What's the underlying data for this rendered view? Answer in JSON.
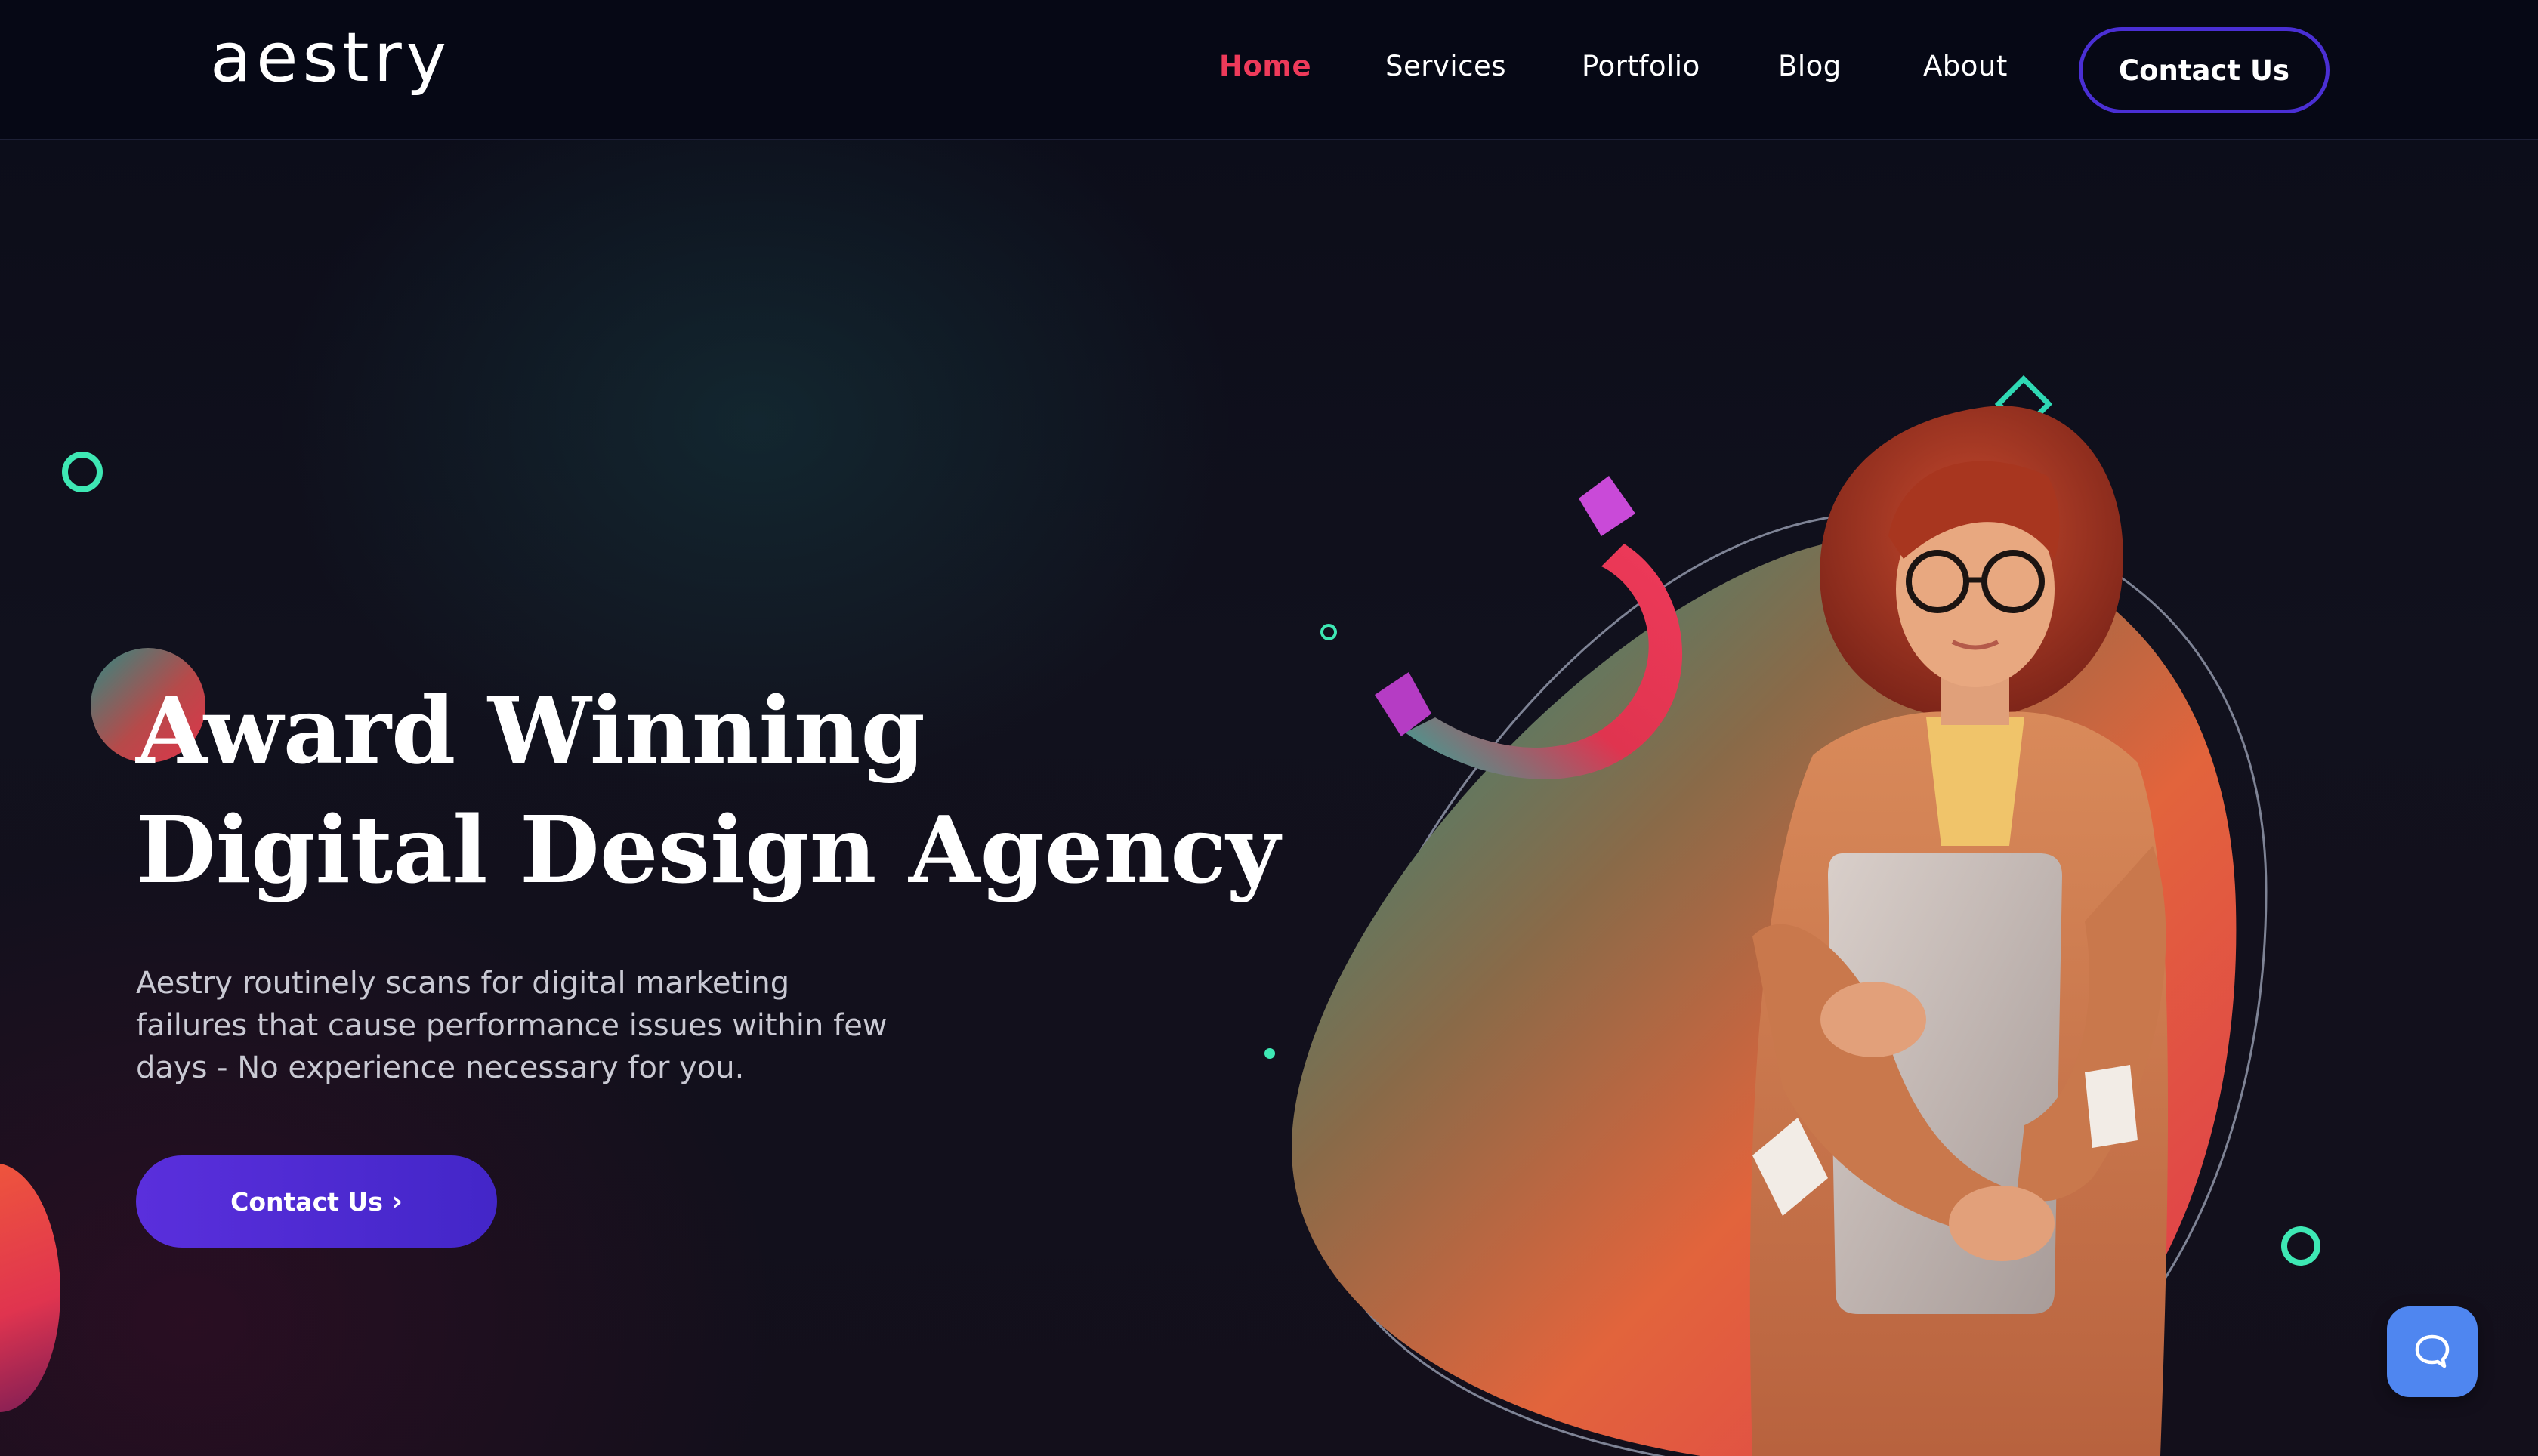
{
  "brand": {
    "logo_text": "aestry"
  },
  "nav": {
    "items": [
      {
        "label": "Home",
        "active": true
      },
      {
        "label": "Services",
        "active": false
      },
      {
        "label": "Portfolio",
        "active": false
      },
      {
        "label": "Blog",
        "active": false
      },
      {
        "label": "About",
        "active": false
      }
    ],
    "cta_label": "Contact Us"
  },
  "hero": {
    "title_line1": "Award Winning",
    "title_line2": "Digital Design Agency",
    "description": "Aestry routinely scans for digital marketing failures that cause performance issues within few days - No experience necessary for you.",
    "cta_label": "Contact Us",
    "cta_icon": "chevron-right-icon"
  },
  "widgets": {
    "chat_icon": "chat-bubble-icon"
  },
  "colors": {
    "background": "#0a0b17",
    "header_bg": "#060815",
    "nav_active": "#ee3a5a",
    "accent_purple": "#4a2fd4",
    "accent_teal": "#3ee8b4",
    "gradient_orange": "#f05a3a",
    "gradient_pink": "#e0344f",
    "chat_blue": "#4f86f0"
  }
}
